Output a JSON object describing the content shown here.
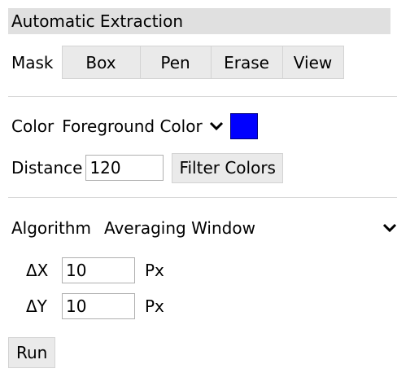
{
  "header": {
    "title": "Automatic Extraction"
  },
  "mask": {
    "label": "Mask",
    "buttons": [
      "Box",
      "Pen",
      "Erase",
      "View"
    ]
  },
  "color": {
    "label": "Color",
    "selected": "Foreground Color",
    "swatch_color": "#0000ff"
  },
  "distance": {
    "label": "Distance",
    "value": "120",
    "filter_label": "Filter Colors"
  },
  "algorithm": {
    "label": "Algorithm",
    "selected": "Averaging Window",
    "dx": {
      "label": "ΔX",
      "value": "10",
      "unit": "Px"
    },
    "dy": {
      "label": "ΔY",
      "value": "10",
      "unit": "Px"
    }
  },
  "run_label": "Run"
}
